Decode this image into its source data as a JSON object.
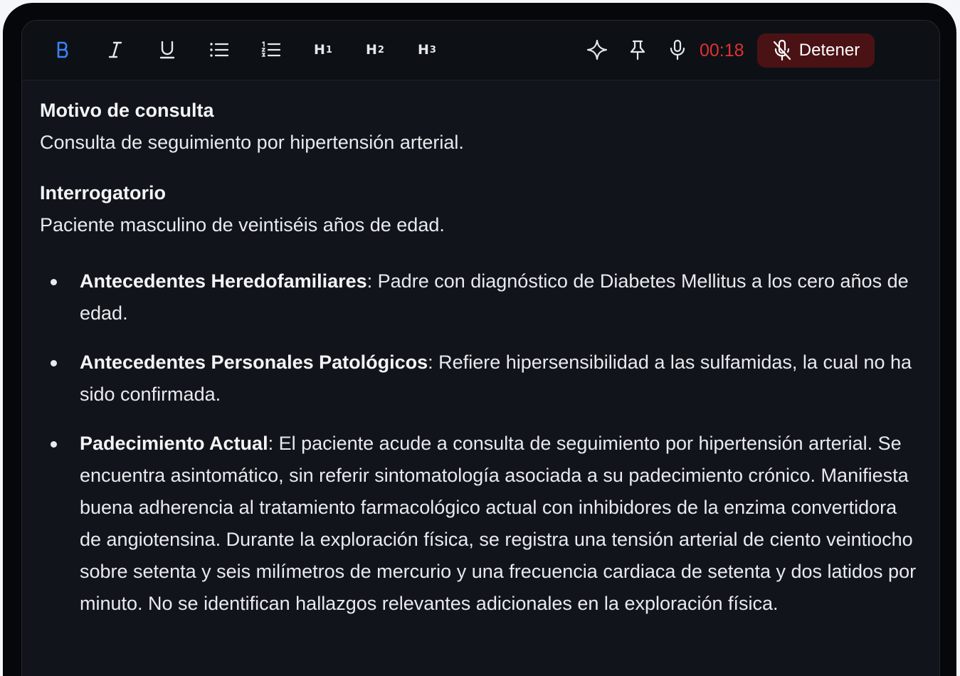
{
  "toolbar": {
    "bold_icon": "bold-icon",
    "italic_icon": "italic-icon",
    "underline_icon": "underline-icon",
    "bullet_list_icon": "bullet-list-icon",
    "ordered_list_icon": "ordered-list-icon",
    "h1": "H",
    "h1_sub": "1",
    "h2": "H",
    "h2_sub": "2",
    "h3": "H",
    "h3_sub": "3",
    "sparkle_icon": "sparkle-icon",
    "pin_icon": "pin-icon",
    "mic_icon": "microphone-icon",
    "timer": "00:18",
    "stop_label": "Detener",
    "stop_icon": "mic-off-icon",
    "active_color": "#3b82f6",
    "record_color": "#e03131"
  },
  "note": {
    "section1_title": "Motivo de consulta",
    "section1_body": "Consulta de seguimiento por hipertensión arterial.",
    "section2_title": "Interrogatorio",
    "section2_body": "Paciente masculino de veintiséis años de edad.",
    "items": [
      {
        "label": "Antecedentes Heredofamiliares",
        "text": ": Padre con diagnóstico de Diabetes Mellitus a los cero años de edad."
      },
      {
        "label": "Antecedentes Personales Patológicos",
        "text": ": Refiere hipersensibilidad a las sulfamidas, la cual no ha sido confirmada."
      },
      {
        "label": "Padecimiento Actual",
        "text": ": El paciente acude a consulta de seguimiento por hipertensión arterial. Se encuentra asintomático, sin referir sintomatología asociada a su padecimiento crónico. Manifiesta buena adherencia al tratamiento farmacológico actual con inhibidores de la enzima convertidora de angiotensina. Durante la exploración física, se registra una tensión arterial de ciento veintiocho sobre setenta y seis milímetros de mercurio y una frecuencia cardiaca de setenta y dos latidos por minuto. No se identifican hallazgos relevantes adicionales en la exploración física."
      }
    ]
  }
}
